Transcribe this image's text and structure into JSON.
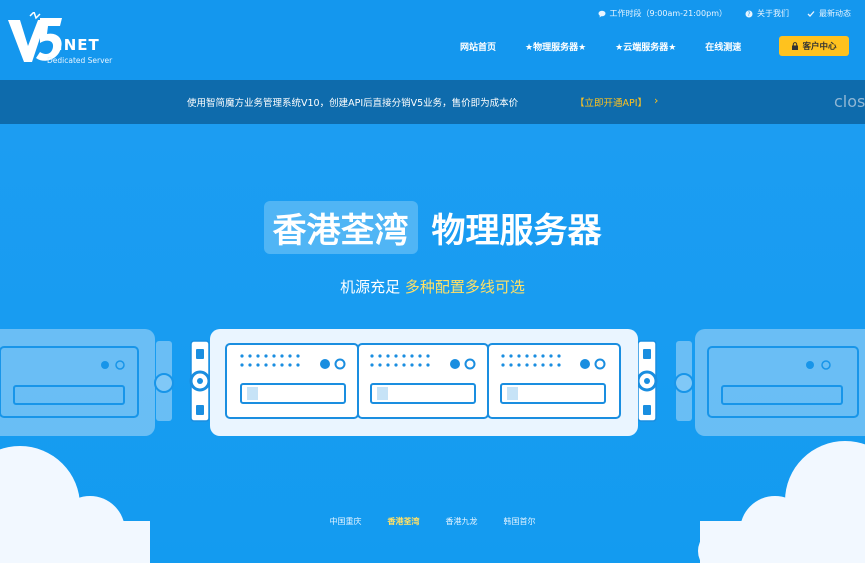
{
  "brand": {
    "net": ".NET",
    "subtitle": "Dedicated Server"
  },
  "topbar": {
    "hours": "工作时段（9:00am-21:00pm）",
    "about": "关于我们",
    "news": "最新动态"
  },
  "nav": {
    "items": [
      "网站首页",
      "★物理服务器★",
      "★云端服务器★",
      "在线测速"
    ],
    "console": "客户中心"
  },
  "notice": {
    "text": "使用智简魔方业务管理系统V10，创建API后直接分销V5业务，售价即为成本价",
    "link": "【立即开通API】",
    "close": "clos"
  },
  "hero": {
    "highlight": "香港荃湾",
    "title": "物理服务器",
    "sub_white": "机源充足",
    "sub_yellow": "多种配置多线可选"
  },
  "locations": [
    "中国重庆",
    "香港荃湾",
    "香港九龙",
    "韩国首尔"
  ],
  "active_location": "香港荃湾",
  "colors": {
    "bg": "#1a9af0",
    "notice": "#0e6bac",
    "accent": "#ffc21e"
  }
}
